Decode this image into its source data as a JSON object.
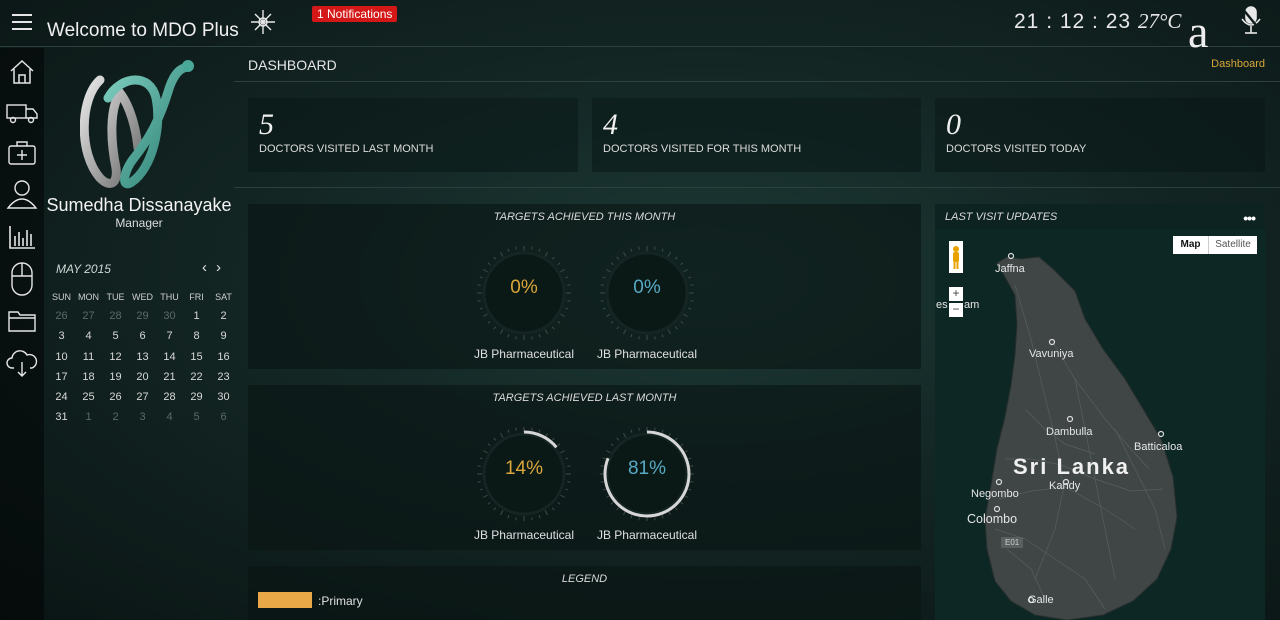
{
  "header": {
    "app_title": "Welcome to MDO Plus",
    "notifications": "1 Notifications",
    "time": "21 : 12 : 23",
    "temperature": "27°C",
    "weather_glyph": "a"
  },
  "sidebar_icons": [
    "home-icon",
    "truck-icon",
    "medical-kit-icon",
    "user-icon",
    "bar-chart-icon",
    "mouse-icon",
    "folder-icon",
    "cloud-download-icon"
  ],
  "profile": {
    "name": "Sumedha Dissanayake",
    "role": "Manager"
  },
  "calendar": {
    "month": "MAY 2015",
    "weekdays": [
      "SUN",
      "MON",
      "TUE",
      "WED",
      "THU",
      "FRI",
      "SAT"
    ],
    "days": [
      {
        "d": "26",
        "m": true
      },
      {
        "d": "27",
        "m": true
      },
      {
        "d": "28",
        "m": true
      },
      {
        "d": "29",
        "m": true
      },
      {
        "d": "30",
        "m": true
      },
      {
        "d": "1"
      },
      {
        "d": "2"
      },
      {
        "d": "3"
      },
      {
        "d": "4"
      },
      {
        "d": "5"
      },
      {
        "d": "6"
      },
      {
        "d": "7"
      },
      {
        "d": "8"
      },
      {
        "d": "9"
      },
      {
        "d": "10"
      },
      {
        "d": "11"
      },
      {
        "d": "12"
      },
      {
        "d": "13"
      },
      {
        "d": "14"
      },
      {
        "d": "15"
      },
      {
        "d": "16"
      },
      {
        "d": "17"
      },
      {
        "d": "18"
      },
      {
        "d": "19"
      },
      {
        "d": "20"
      },
      {
        "d": "21"
      },
      {
        "d": "22"
      },
      {
        "d": "23"
      },
      {
        "d": "24"
      },
      {
        "d": "25"
      },
      {
        "d": "26"
      },
      {
        "d": "27"
      },
      {
        "d": "28"
      },
      {
        "d": "29"
      },
      {
        "d": "30"
      },
      {
        "d": "31"
      },
      {
        "d": "1",
        "m": true
      },
      {
        "d": "2",
        "m": true
      },
      {
        "d": "3",
        "m": true
      },
      {
        "d": "4",
        "m": true
      },
      {
        "d": "5",
        "m": true
      },
      {
        "d": "6",
        "m": true
      }
    ]
  },
  "page": {
    "title": "DASHBOARD",
    "breadcrumb": "Dashboard"
  },
  "stats": [
    {
      "value": "5",
      "label": "DOCTORS VISITED LAST MONTH"
    },
    {
      "value": "4",
      "label": "DOCTORS VISITED FOR THIS MONTH"
    },
    {
      "value": "0",
      "label": "DOCTORS VISITED TODAY"
    }
  ],
  "targets_this_month": {
    "title": "TARGETS ACHIEVED THIS MONTH",
    "gauges": [
      {
        "pct": "0%",
        "value": 0,
        "name": "JB Pharmaceutical",
        "color": "#d9a73a"
      },
      {
        "pct": "0%",
        "value": 0,
        "name": "JB Pharmaceutical",
        "color": "#57aac4"
      }
    ]
  },
  "targets_last_month": {
    "title": "TARGETS ACHIEVED LAST MONTH",
    "gauges": [
      {
        "pct": "14%",
        "value": 14,
        "name": "JB Pharmaceutical",
        "color": "#d9a73a"
      },
      {
        "pct": "81%",
        "value": 81,
        "name": "JB Pharmaceutical",
        "color": "#57aac4"
      }
    ]
  },
  "legend": {
    "title": "LEGEND",
    "items": [
      {
        "label": ":Primary",
        "color": "#e8a848"
      }
    ]
  },
  "map": {
    "title": "LAST VISIT UPDATES",
    "more": "•••",
    "btn_map": "Map",
    "btn_satellite": "Satellite",
    "zoom_in": "+",
    "zoom_out": "−",
    "country": "Sri Lanka",
    "places": [
      "Jaffna",
      "es",
      "am",
      "Vavuniya",
      "Dambulla",
      "Batticaloa",
      "Negombo",
      "Kandy",
      "Colombo",
      "Galle",
      "E01"
    ]
  }
}
